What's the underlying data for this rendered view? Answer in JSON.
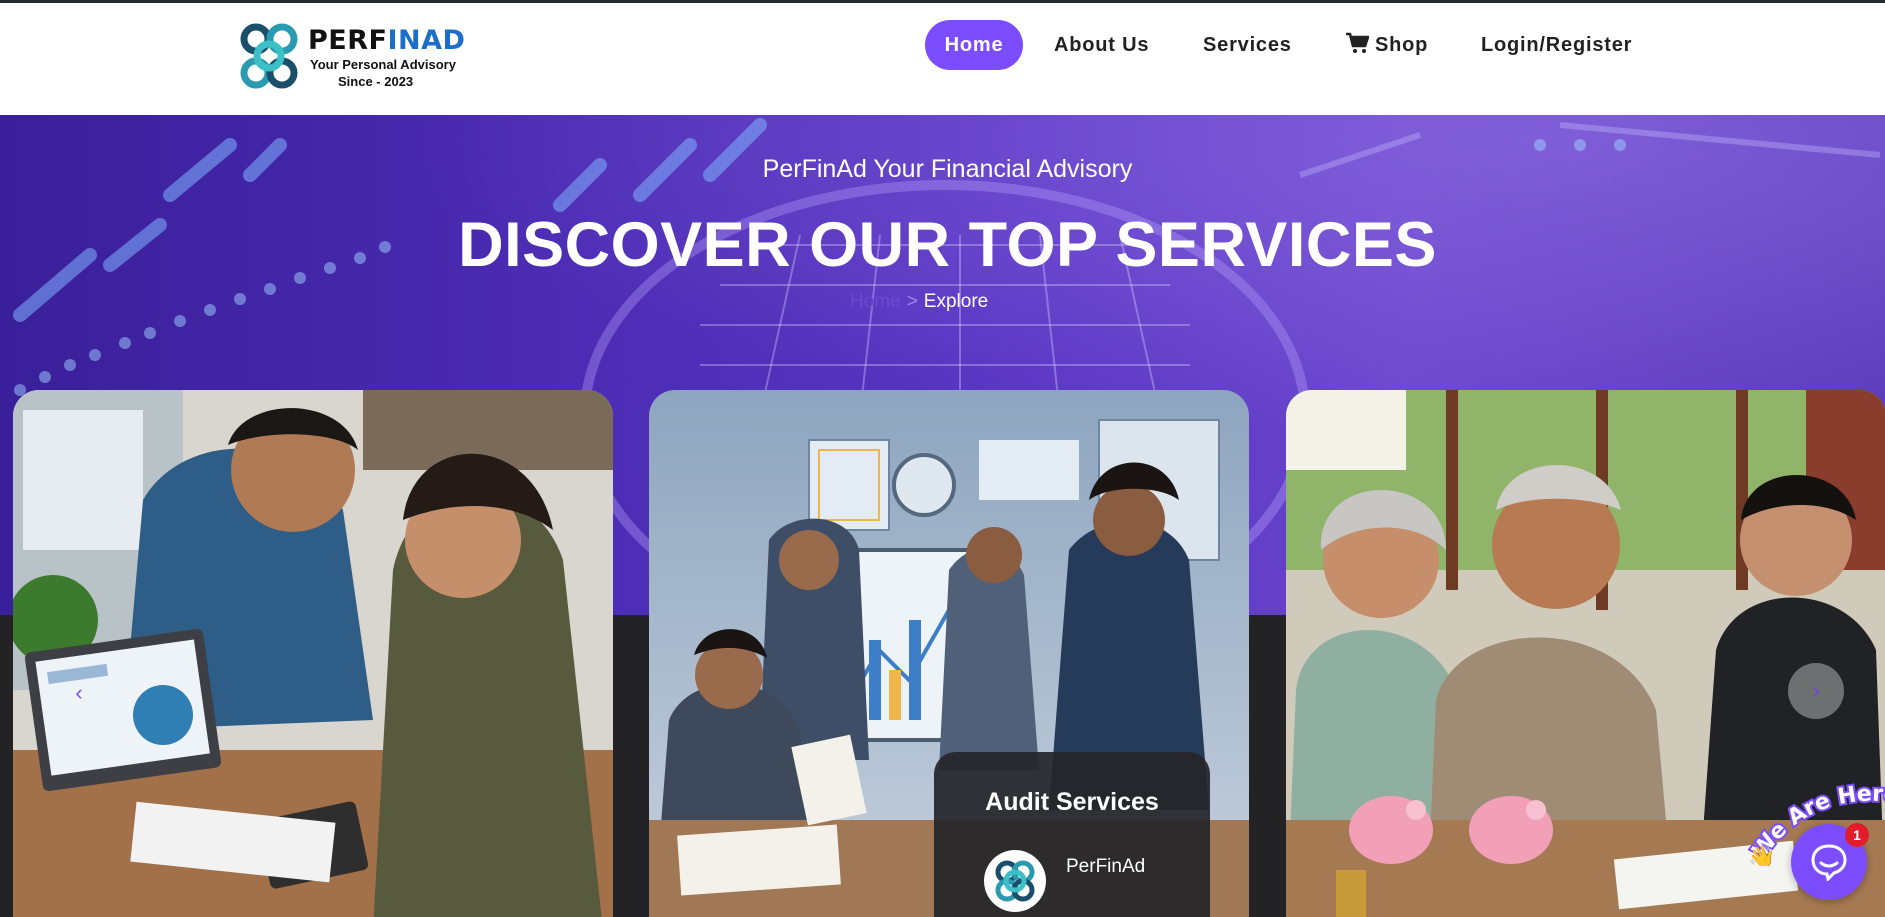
{
  "brand": {
    "name_part1": "PERF",
    "name_part2": "INAD",
    "tagline": "Your Personal Advisory",
    "since": "Since - 2023"
  },
  "nav": {
    "items": [
      {
        "label": "Home",
        "active": true
      },
      {
        "label": "About Us"
      },
      {
        "label": "Services"
      },
      {
        "label": "Shop",
        "icon": "cart-icon"
      },
      {
        "label": "Login/Register"
      }
    ]
  },
  "hero": {
    "tagline": "PerFinAd Your Financial Advisory",
    "title": "DISCOVER OUR TOP SERVICES",
    "breadcrumb": {
      "home": "Home",
      "separator": ">",
      "current": "Explore"
    }
  },
  "cards": [
    {
      "image": "couple-debt-planning-photo"
    },
    {
      "image": "audit-team-photo",
      "title": "Audit Services",
      "author": "PerFinAd"
    },
    {
      "image": "senior-couple-advisor-photo"
    }
  ],
  "slider": {
    "prev": "‹",
    "next": "›"
  },
  "chat": {
    "label": "We Are Here!",
    "badge": "1"
  },
  "colors": {
    "accent": "#7c4dff",
    "hero": "#4b2cb3",
    "dark": "#232326"
  }
}
